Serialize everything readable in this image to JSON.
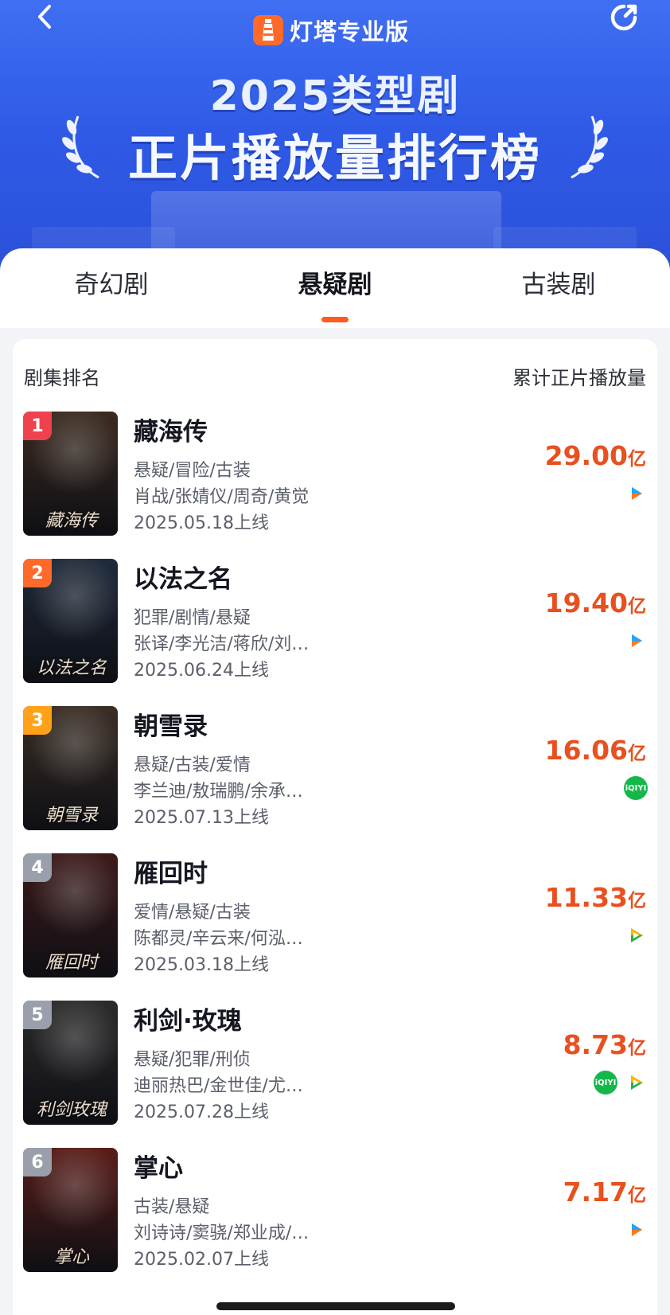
{
  "brand": {
    "name": "灯塔专业版",
    "logo_icon": "lighthouse-icon"
  },
  "header": {
    "title_line1": "2025类型剧",
    "title_line2": "正片播放量排行榜",
    "back_icon": "chevron-left-icon",
    "share_icon": "share-icon"
  },
  "tabs": [
    {
      "label": "奇幻剧",
      "active": false
    },
    {
      "label": "悬疑剧",
      "active": true
    },
    {
      "label": "古装剧",
      "active": false
    }
  ],
  "columns": {
    "left": "剧集排名",
    "right": "累计正片播放量"
  },
  "shows": [
    {
      "rank": "1",
      "title": "藏海传",
      "genres": "悬疑/冒险/古装",
      "cast": "肖战/张婧仪/周奇/黄觉",
      "date": "2025.05.18上线",
      "views": "29.00",
      "unit": "亿",
      "platforms": [
        "youku"
      ],
      "poster_caption": "藏海传"
    },
    {
      "rank": "2",
      "title": "以法之名",
      "genres": "犯罪/剧情/悬疑",
      "cast": "张译/李光洁/蒋欣/刘…",
      "date": "2025.06.24上线",
      "views": "19.40",
      "unit": "亿",
      "platforms": [
        "youku"
      ],
      "poster_caption": "以法之名"
    },
    {
      "rank": "3",
      "title": "朝雪录",
      "genres": "悬疑/古装/爱情",
      "cast": "李兰迪/敖瑞鹏/余承…",
      "date": "2025.07.13上线",
      "views": "16.06",
      "unit": "亿",
      "platforms": [
        "iqiyi"
      ],
      "poster_caption": "朝雪录"
    },
    {
      "rank": "4",
      "title": "雁回时",
      "genres": "爱情/悬疑/古装",
      "cast": "陈都灵/辛云来/何泓…",
      "date": "2025.03.18上线",
      "views": "11.33",
      "unit": "亿",
      "platforms": [
        "tencent"
      ],
      "poster_caption": "雁回时"
    },
    {
      "rank": "5",
      "title": "利剑·玫瑰",
      "genres": "悬疑/犯罪/刑侦",
      "cast": "迪丽热巴/金世佳/尤…",
      "date": "2025.07.28上线",
      "views": "8.73",
      "unit": "亿",
      "platforms": [
        "iqiyi",
        "tencent"
      ],
      "poster_caption": "利剑玫瑰"
    },
    {
      "rank": "6",
      "title": "掌心",
      "genres": "古装/悬疑",
      "cast": "刘诗诗/窦骁/郑业成/…",
      "date": "2025.02.07上线",
      "views": "7.17",
      "unit": "亿",
      "platforms": [
        "youku"
      ],
      "poster_caption": "掌心"
    }
  ],
  "colors": {
    "accent": "#e8501f",
    "tab_indicator": "#ff5a1f",
    "banner": "#2f5ae6",
    "rank_badges": [
      "#f0414e",
      "#ff6a2a",
      "#ffa21a",
      "#9aa0ab",
      "#9aa0ab",
      "#9aa0ab"
    ],
    "poster_colors": [
      "#3b2a1f",
      "#1f2a3a",
      "#3a2e24",
      "#3d1a1a",
      "#2b2b2b",
      "#5a1d18"
    ]
  }
}
